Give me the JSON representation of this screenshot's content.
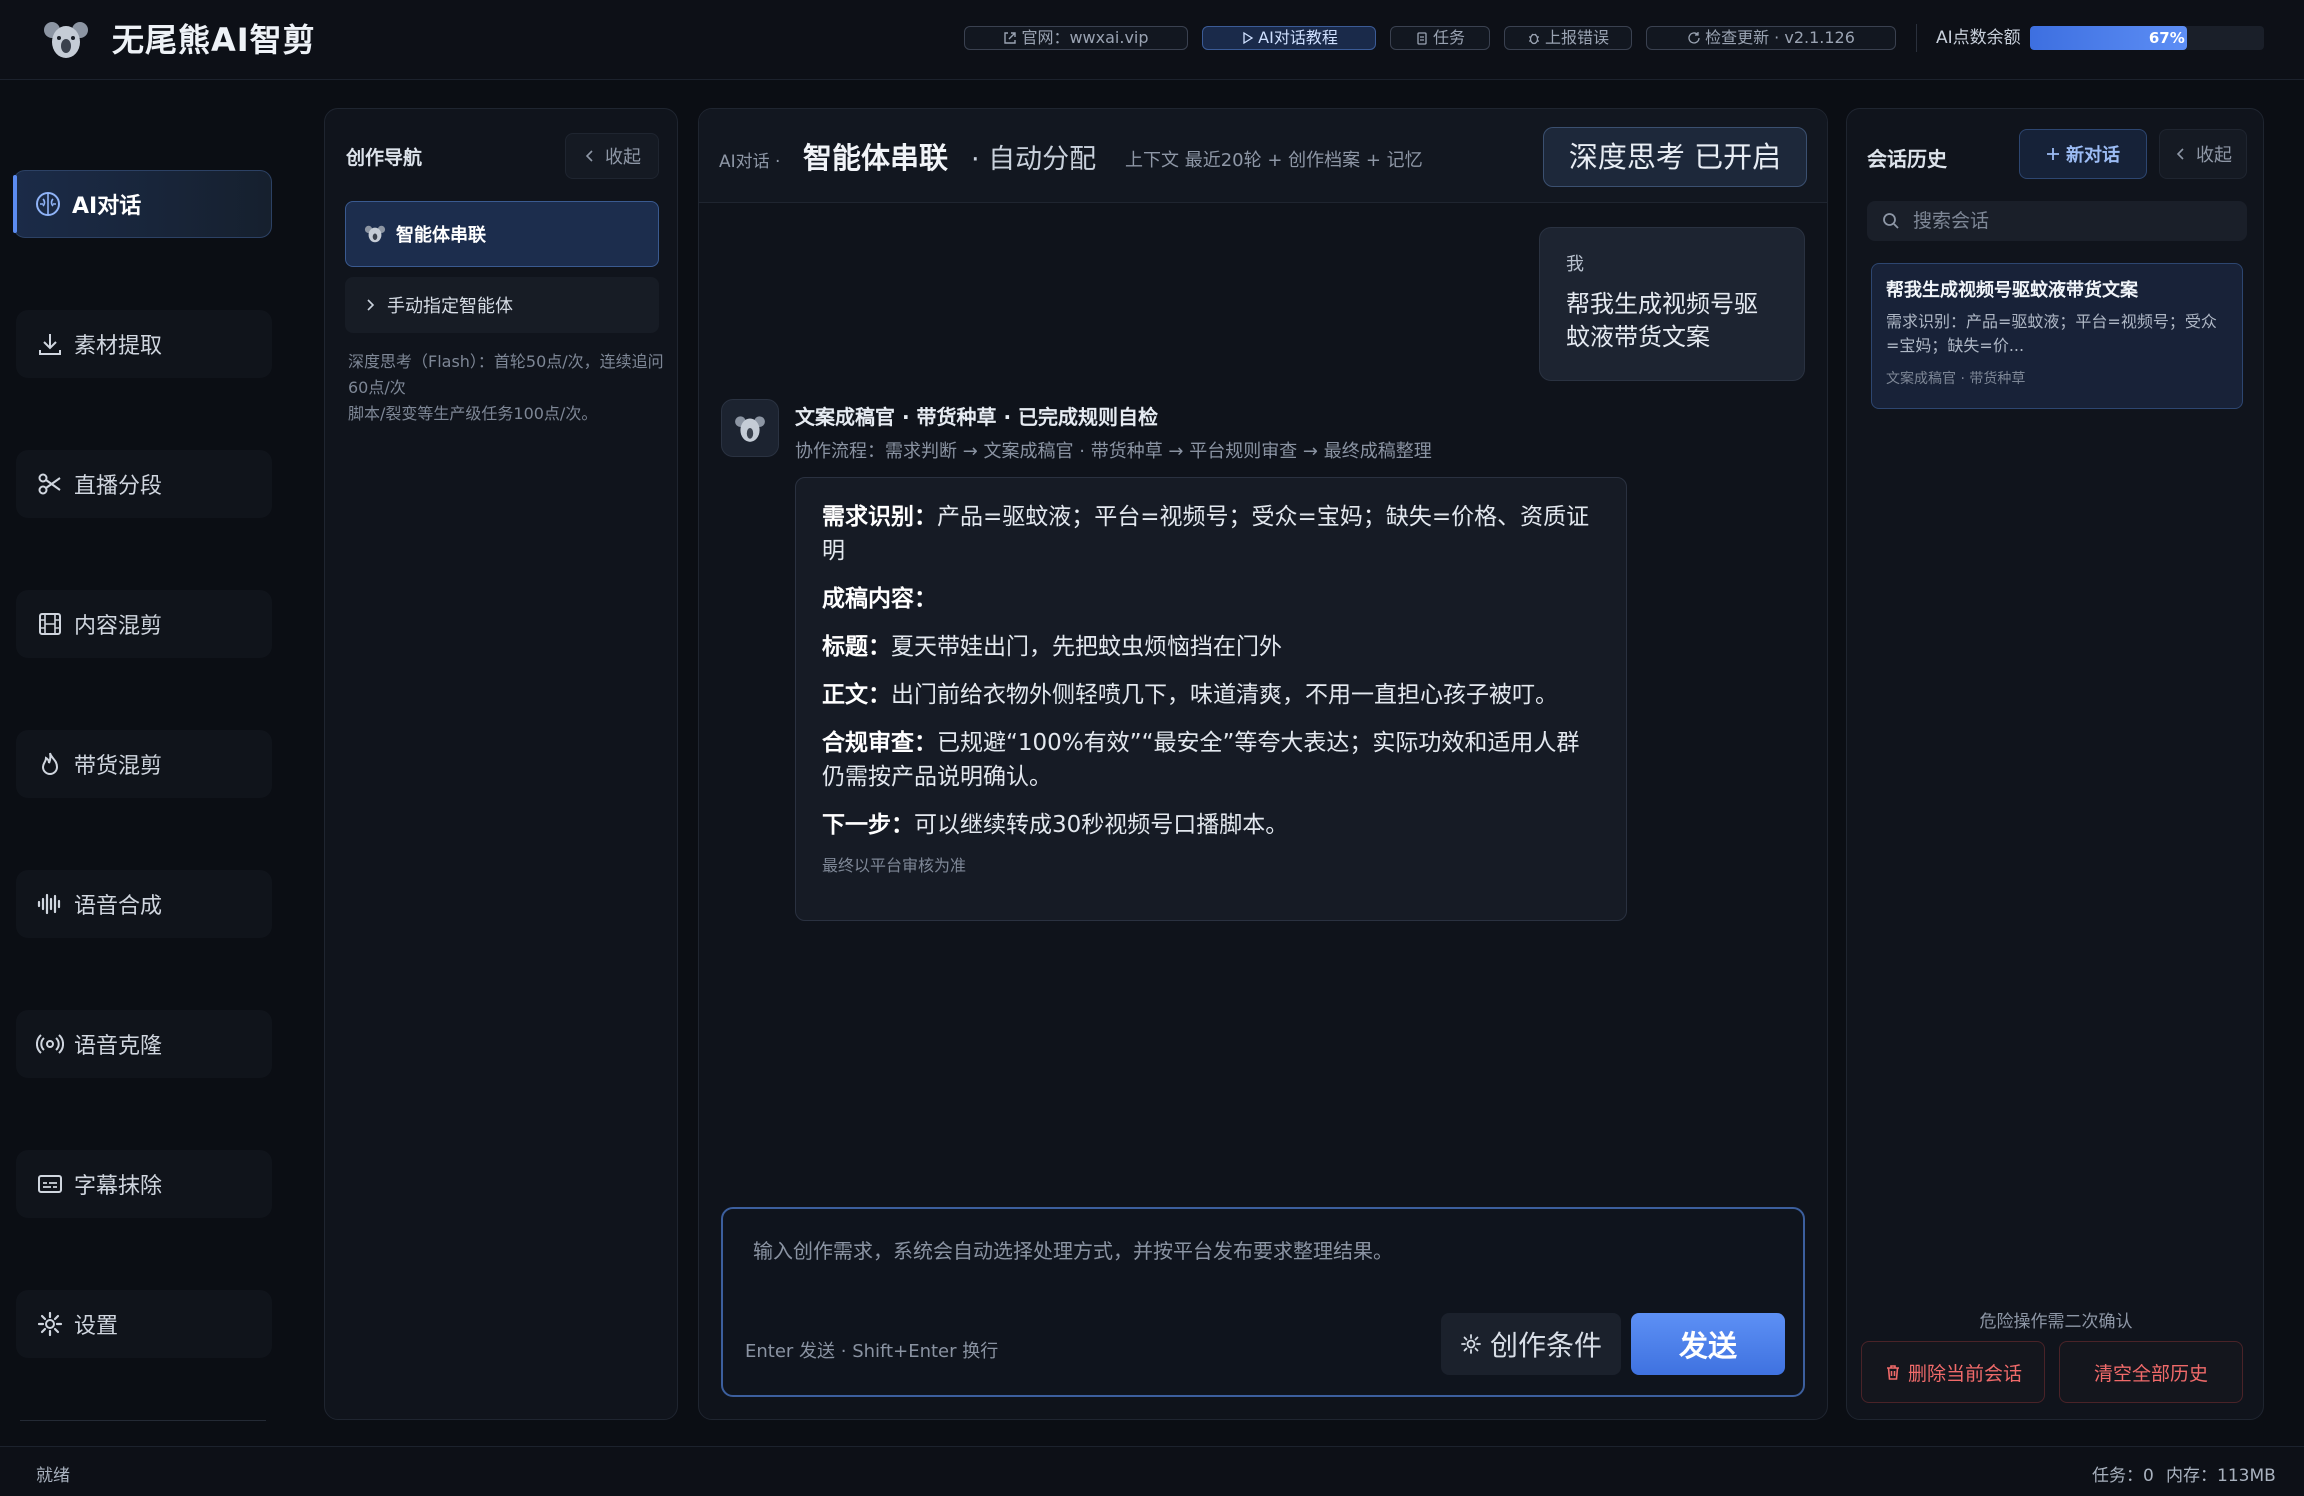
{
  "header": {
    "app_title": "无尾熊AI智剪",
    "links": [
      {
        "label": "官网：wwxai.vip",
        "icon": "external-link-icon"
      },
      {
        "label": "AI对话教程",
        "icon": "play-icon",
        "active": true
      },
      {
        "label": "任务",
        "icon": "clipboard-icon"
      },
      {
        "label": "上报错误",
        "icon": "bug-icon"
      },
      {
        "label": "检查更新 · v2.1.126",
        "icon": "refresh-icon"
      }
    ],
    "quota_label": "AI点数余额",
    "quota_percent": 67,
    "quota_text": "67%"
  },
  "sidebar": {
    "items": [
      {
        "label": "AI对话",
        "icon": "brain-icon",
        "active": true
      },
      {
        "label": "素材提取",
        "icon": "download-icon"
      },
      {
        "label": "直播分段",
        "icon": "scissors-icon"
      },
      {
        "label": "内容混剪",
        "icon": "film-icon"
      },
      {
        "label": "带货混剪",
        "icon": "flame-icon"
      },
      {
        "label": "语音合成",
        "icon": "waveform-icon"
      },
      {
        "label": "语音克隆",
        "icon": "broadcast-icon"
      },
      {
        "label": "字幕抹除",
        "icon": "subtitles-icon"
      },
      {
        "label": "设置",
        "icon": "gear-icon"
      }
    ]
  },
  "nav_panel": {
    "title": "创作导航",
    "collapse_label": "收起",
    "items": [
      {
        "label": "智能体串联",
        "active": true
      },
      {
        "label": "手动指定智能体"
      }
    ],
    "note_line1": "深度思考（Flash）：首轮50点/次，连续追问60点/次",
    "note_line2": "脚本/裂变等生产级任务100点/次。"
  },
  "chat": {
    "crumb": "AI对话 ·",
    "title": "智能体串联",
    "mode": "· 自动分配",
    "context": "上下文 最近20轮 + 创作档案 + 记忆",
    "think_badge": "深度思考 已开启",
    "user_name": "我",
    "user_message": "帮我生成视频号驱蚊液带货文案",
    "ai_head": "文案成稿官 · 带货种草 · 已完成规则自检",
    "ai_flow": "协作流程：需求判断 → 文案成稿官 · 带货种草 → 平台规则审查 → 最终成稿整理",
    "ai_lines": [
      {
        "label": "需求识别：",
        "text": "产品=驱蚊液；平台=视频号；受众=宝妈；缺失=价格、资质证明"
      },
      {
        "label": "成稿内容：",
        "text": ""
      },
      {
        "label": "标题：",
        "text": "夏天带娃出门，先把蚊虫烦恼挡在门外"
      },
      {
        "label": "正文：",
        "text": "出门前给衣物外侧轻喷几下，味道清爽，不用一直担心孩子被叮。"
      },
      {
        "label": "合规审查：",
        "text": "已规避“100%有效”“最安全”等夸大表达；实际功效和适用人群仍需按产品说明确认。"
      },
      {
        "label": "下一步：",
        "text": "可以继续转成30秒视频号口播脚本。"
      }
    ],
    "ai_footer": "最终以平台审核为准",
    "composer_placeholder": "输入创作需求，系统会自动选择处理方式，并按平台发布要求整理结果。",
    "composer_hint": "Enter 发送 · Shift+Enter 换行",
    "conditions_label": "创作条件",
    "send_label": "发送"
  },
  "history": {
    "title": "会话历史",
    "new_chat_label": "新对话",
    "collapse_label": "收起",
    "search_placeholder": "搜索会话",
    "items": [
      {
        "title": "帮我生成视频号驱蚊液带货文案",
        "summary": "需求识别：产品=驱蚊液；平台=视频号；受众=宝妈；缺失=价...",
        "tags": "文案成稿官 · 带货种草"
      }
    ],
    "danger_note": "危险操作需二次确认",
    "delete_current_label": "删除当前会话",
    "clear_all_label": "清空全部历史"
  },
  "status": {
    "ready": "就绪",
    "tasks": "任务：0",
    "memory": "内存：113MB"
  }
}
